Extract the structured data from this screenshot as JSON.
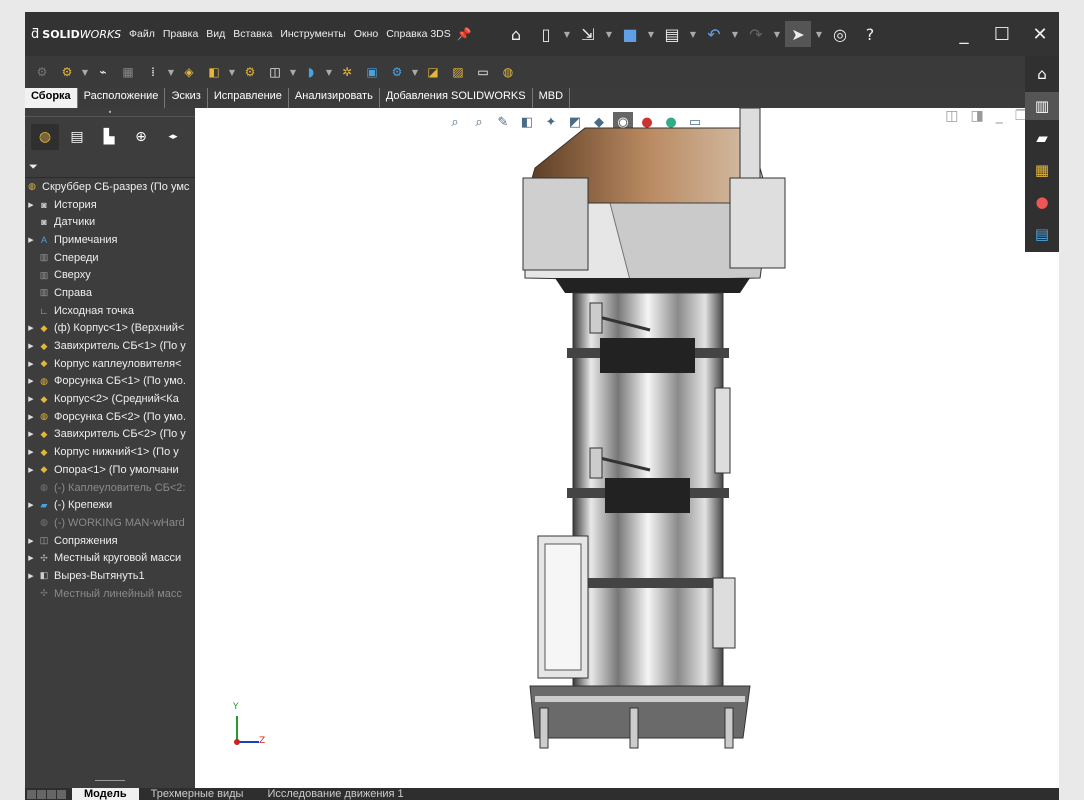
{
  "app": {
    "brand_prefix": "SOLID",
    "brand_suffix": "WORKS",
    "menus": [
      "Файл",
      "Правка",
      "Вид",
      "Вставка",
      "Инструменты",
      "Окно",
      "Справка 3DS"
    ]
  },
  "command_tabs": [
    "Сборка",
    "Расположение",
    "Эскиз",
    "Исправление",
    "Анализировать",
    "Добавления SOLIDWORKS",
    "MBD"
  ],
  "tree": {
    "root": "Скруббер СБ-разрез  (По умс",
    "items": [
      {
        "label": "История",
        "arrow": true,
        "icon": "history-icon",
        "dim": false
      },
      {
        "label": "Датчики",
        "arrow": false,
        "icon": "sensor-icon",
        "dim": false
      },
      {
        "label": "Примечания",
        "arrow": true,
        "icon": "annotation-icon",
        "dim": false
      },
      {
        "label": "Спереди",
        "arrow": false,
        "icon": "plane-icon",
        "dim": false
      },
      {
        "label": "Сверху",
        "arrow": false,
        "icon": "plane-icon",
        "dim": false
      },
      {
        "label": "Справа",
        "arrow": false,
        "icon": "plane-icon",
        "dim": false
      },
      {
        "label": "Исходная точка",
        "arrow": false,
        "icon": "origin-icon",
        "dim": false
      },
      {
        "label": "(ф) Корпус<1> (Верхний<",
        "arrow": true,
        "icon": "part-icon",
        "dim": false
      },
      {
        "label": "Завихритель СБ<1> (По у",
        "arrow": true,
        "icon": "part-icon",
        "dim": false
      },
      {
        "label": "Корпус каплеуловителя<",
        "arrow": true,
        "icon": "part-icon",
        "dim": false
      },
      {
        "label": "Форсунка СБ<1> (По умо.",
        "arrow": true,
        "icon": "assembly-icon",
        "dim": false
      },
      {
        "label": "Корпус<2> (Средний<Ка",
        "arrow": true,
        "icon": "part-icon",
        "dim": false
      },
      {
        "label": "Форсунка СБ<2> (По умо.",
        "arrow": true,
        "icon": "assembly-icon",
        "dim": false
      },
      {
        "label": "Завихритель СБ<2> (По у",
        "arrow": true,
        "icon": "part-icon",
        "dim": false
      },
      {
        "label": "Корпус нижний<1> (По у",
        "arrow": true,
        "icon": "part-icon",
        "dim": false
      },
      {
        "label": "Опора<1> (По умолчани",
        "arrow": true,
        "icon": "part-icon",
        "dim": false
      },
      {
        "label": "(-) Каплеуловитель СБ<2:",
        "arrow": false,
        "icon": "assembly-icon",
        "dim": true
      },
      {
        "label": "(-) Крепежи",
        "arrow": true,
        "icon": "folder-icon",
        "dim": false
      },
      {
        "label": "(-) WORKING MAN-wHard",
        "arrow": false,
        "icon": "assembly-icon",
        "dim": true
      },
      {
        "label": "Сопряжения",
        "arrow": true,
        "icon": "mates-icon",
        "dim": false
      },
      {
        "label": "Местный круговой масси",
        "arrow": true,
        "icon": "pattern-icon",
        "dim": false
      },
      {
        "label": "Вырез-Вытянуть1",
        "arrow": true,
        "icon": "cut-icon",
        "dim": false
      },
      {
        "label": "Местный линейный масс",
        "arrow": false,
        "icon": "pattern-icon",
        "dim": true
      }
    ]
  },
  "bottom_tabs": [
    "Модель",
    "Трехмерные виды",
    "Исследование движения 1"
  ],
  "triad": {
    "y": "Y",
    "z": "Z"
  }
}
